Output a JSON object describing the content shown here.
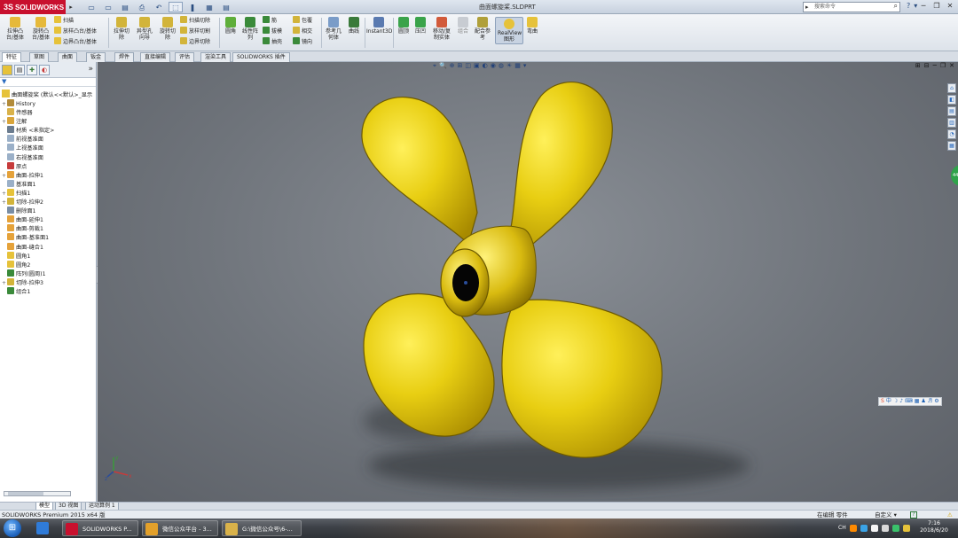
{
  "titlebar": {
    "logo": "SOLIDWORKS",
    "logo_ds": "3S",
    "document_title": "曲面螺旋桨.SLDPRT",
    "search_placeholder": "搜索命令",
    "window_controls": [
      "─",
      "❐",
      "✕"
    ],
    "help_glyphs": [
      "?",
      "▾",
      "─",
      "❐",
      "✕"
    ]
  },
  "quick_access": {
    "buttons": [
      "▭",
      "▭",
      "▤",
      "⎙",
      "↶",
      "⬚",
      "❚",
      "▦",
      "▤"
    ]
  },
  "ribbon": {
    "extrude_boss": "拉伸凸\n台/基体",
    "revolve_boss": "旋转凸\n台/基体",
    "sweep": "扫描",
    "loft": "放样凸台/基体",
    "boundary_boss": "边界凸台/基体",
    "extrude_cut": "拉伸切\n除",
    "hole_wizard": "异型孔\n向导",
    "revolve_cut": "旋转切\n除",
    "swept_cut": "扫描切除",
    "lofted_cut": "放样切割",
    "boundary_cut": "边界切除",
    "fillet": "圆角",
    "linear_pattern": "线性阵\n列",
    "rib": "筋",
    "draft": "拔模",
    "shell": "抽壳",
    "wrap": "包覆",
    "intersect": "相交",
    "mirror": "镜向",
    "ref_geometry": "参考几\n何体",
    "curves": "曲线",
    "instant3d": "Instant3D",
    "dome": "圆顶",
    "indent": "压凹",
    "move_copy_bodies": "移动/复\n制实体",
    "combine": "组合",
    "mate_reference": "配合参\n考",
    "realview": "RealView\n图形",
    "taipei": "弯曲"
  },
  "command_tabs": [
    "特征",
    "草图",
    "曲面",
    "钣金",
    "焊件",
    "直接编辑",
    "评估",
    "渲染工具",
    "SOLIDWORKS 插件"
  ],
  "feature_manager": {
    "root": "曲面螺旋桨 (默认<<默认>_显示",
    "tree": [
      {
        "label": "History",
        "exp": "+",
        "icon": "#b28b3a"
      },
      {
        "label": "传感器",
        "exp": "",
        "icon": "#d9b24a"
      },
      {
        "label": "注解",
        "exp": "+",
        "icon": "#d9a53a"
      },
      {
        "label": "材质 <未指定>",
        "exp": "",
        "icon": "#6b7c8f"
      },
      {
        "label": "前视基准面",
        "exp": "",
        "icon": "#9bb0c8"
      },
      {
        "label": "上视基准面",
        "exp": "",
        "icon": "#9bb0c8"
      },
      {
        "label": "右视基准面",
        "exp": "",
        "icon": "#9bb0c8"
      },
      {
        "label": "原点",
        "exp": "",
        "icon": "#c63b3b"
      },
      {
        "label": "曲面-拉伸1",
        "exp": "+",
        "icon": "#e5a23a"
      },
      {
        "label": "基准面1",
        "exp": "",
        "icon": "#9bb0c8"
      },
      {
        "label": "扫描1",
        "exp": "+",
        "icon": "#e6c23a"
      },
      {
        "label": "切除-拉伸2",
        "exp": "+",
        "icon": "#d2b43a"
      },
      {
        "label": "删除面1",
        "exp": "",
        "icon": "#7a8ea5"
      },
      {
        "label": "曲面-延伸1",
        "exp": "",
        "icon": "#e5a23a"
      },
      {
        "label": "曲面-剪裁1",
        "exp": "",
        "icon": "#e5a23a"
      },
      {
        "label": "曲面-基准面1",
        "exp": "",
        "icon": "#e5a23a"
      },
      {
        "label": "曲面-缝合1",
        "exp": "",
        "icon": "#e5a23a"
      },
      {
        "label": "圆角1",
        "exp": "",
        "icon": "#e6c23a"
      },
      {
        "label": "圆角2",
        "exp": "",
        "icon": "#e6c23a"
      },
      {
        "label": "阵列(圆周)1",
        "exp": "",
        "icon": "#3a8a3a"
      },
      {
        "label": "切除-拉伸3",
        "exp": "+",
        "icon": "#d2b43a"
      },
      {
        "label": "组合1",
        "exp": "",
        "icon": "#3a8a3a"
      }
    ]
  },
  "viewport": {
    "heads_up": [
      "⌖",
      "🔍",
      "⊕",
      "⊞",
      "◫",
      "▣",
      "◐",
      "◉",
      "◍",
      "☀",
      "▦",
      "▾"
    ],
    "vp_controls": [
      "⊞",
      "⊟",
      "─",
      "❐",
      "✕"
    ],
    "task_pane": [
      "⌂",
      "◧",
      "▤",
      "▥",
      "◔",
      "▦"
    ],
    "green_btn_text": "44%",
    "ime_items": [
      "S",
      "中",
      "☽",
      "♪",
      "⌨",
      "▦",
      "♟",
      "♬",
      "⚙"
    ],
    "triad_labels": {
      "x": "x",
      "y": "y",
      "z": "z"
    },
    "propeller_color": "#e2c200"
  },
  "bottom_tabs": [
    "模型",
    "3D 视图",
    "运动算例 1"
  ],
  "statusbar": {
    "left": "SOLIDWORKS Premium 2015 x64 版",
    "editing": "在编辑 零件",
    "units": "自定义",
    "units_arrow": "▾",
    "help": "?"
  },
  "taskbar": {
    "start_glyph": "⊞",
    "apps": [
      {
        "label": "",
        "color": "#2f7bd8"
      },
      {
        "label": "SOLIDWORKS P...",
        "color": "#c8102e"
      },
      {
        "label": "微信公众平台 - 3...",
        "color": "#e3a02a"
      },
      {
        "label": "G:\\微信公众号\\6-...",
        "color": "#d9b24a"
      }
    ],
    "tray_text": "CH",
    "tray_colors": [
      "#ff8a00",
      "#3aa3e6",
      "#f5f5f5",
      "#d9d9d9",
      "#3ac26b",
      "#e6c23a"
    ],
    "time": "7:16",
    "date": "2018/6/20"
  }
}
